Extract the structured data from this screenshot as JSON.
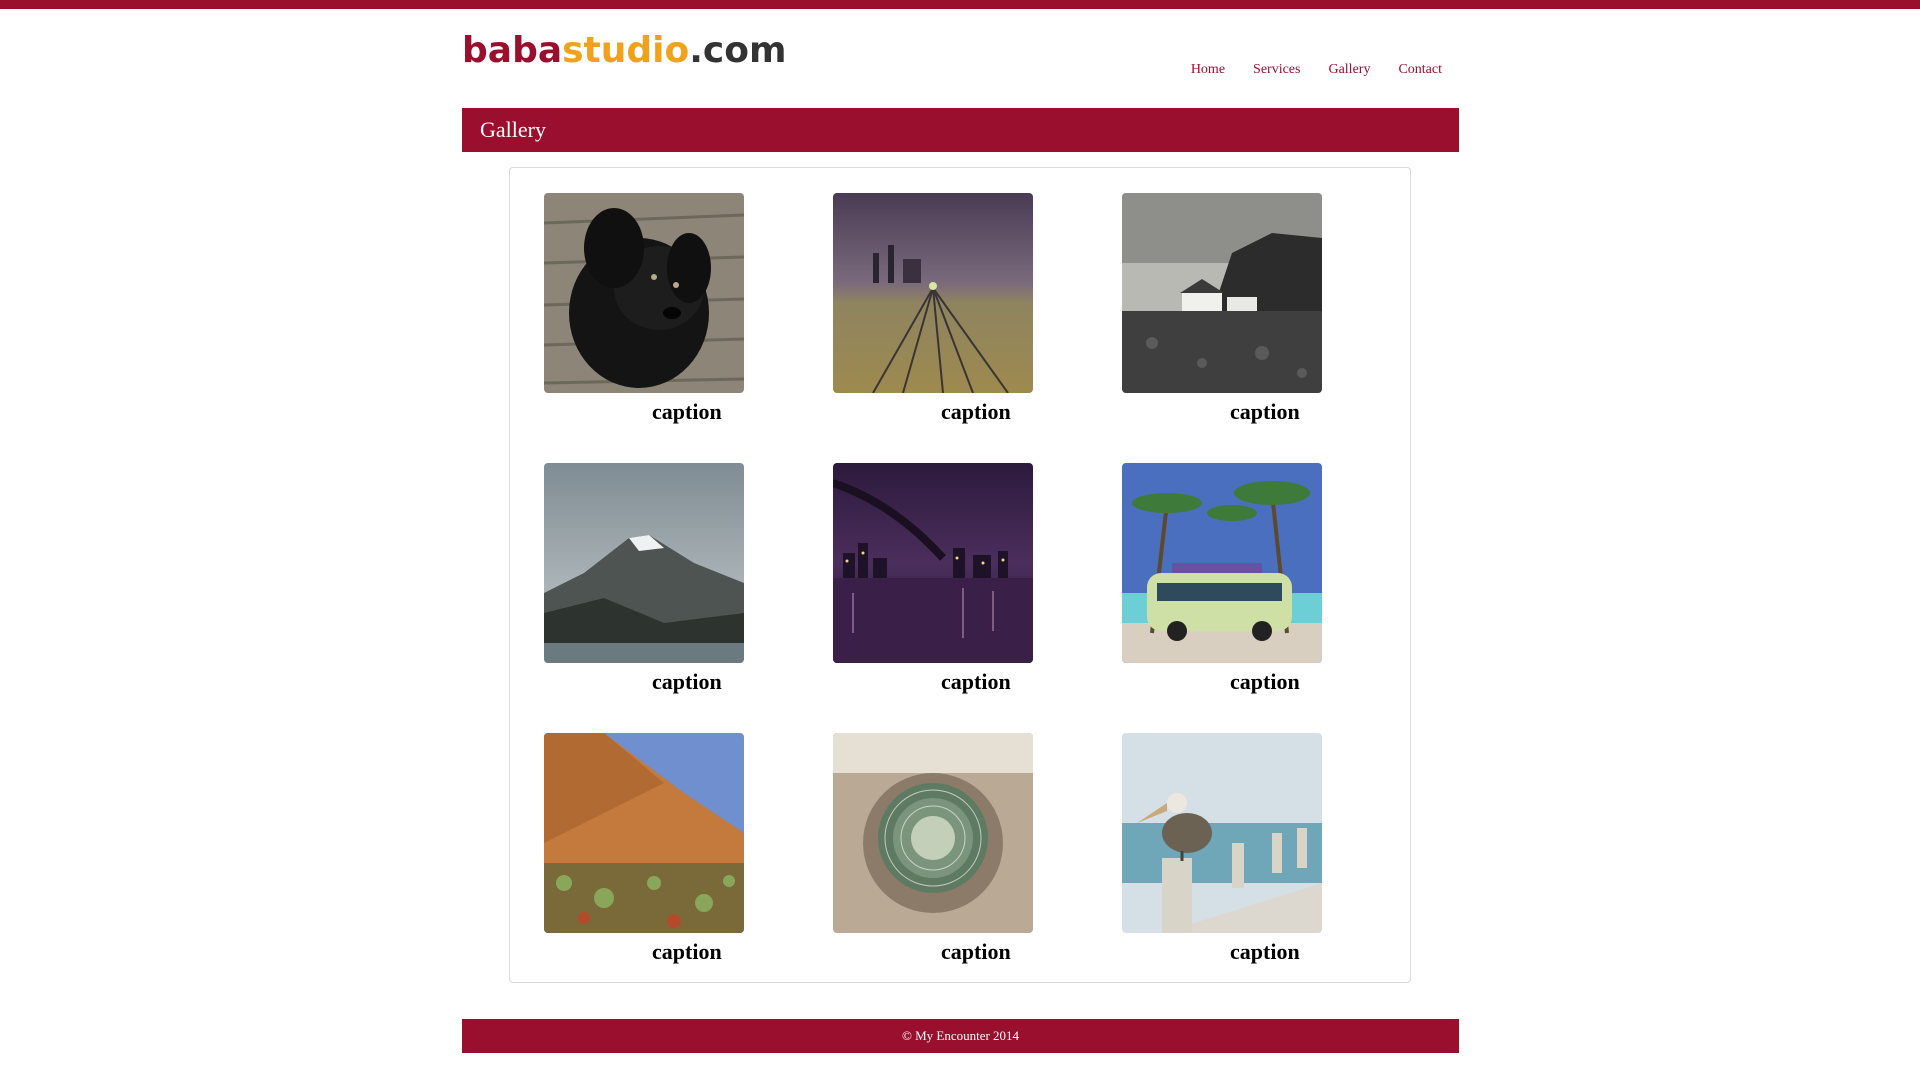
{
  "brand": {
    "logo_part1": "baba",
    "logo_part2": "studio",
    "logo_part3": ".com"
  },
  "nav": {
    "items": [
      "Home",
      "Services",
      "Gallery",
      "Contact"
    ]
  },
  "page": {
    "title": "Gallery"
  },
  "gallery": {
    "items": [
      {
        "caption": "caption",
        "image": "black-puppy-on-wood-deck"
      },
      {
        "caption": "caption",
        "image": "railway-tracks-at-night"
      },
      {
        "caption": "caption",
        "image": "coastal-cliff-houses"
      },
      {
        "caption": "caption",
        "image": "snowy-mountain-lake"
      },
      {
        "caption": "caption",
        "image": "bridge-city-night"
      },
      {
        "caption": "caption",
        "image": "van-under-palm-trees"
      },
      {
        "caption": "caption",
        "image": "red-rock-desert"
      },
      {
        "caption": "caption",
        "image": "cactus-top-view"
      },
      {
        "caption": "caption",
        "image": "pelican-on-pier"
      }
    ]
  },
  "footer": {
    "text": "© My Encounter 2014"
  },
  "colors": {
    "brand": "#9a0f2d",
    "accent": "#f0a21c",
    "dark": "#333333"
  }
}
